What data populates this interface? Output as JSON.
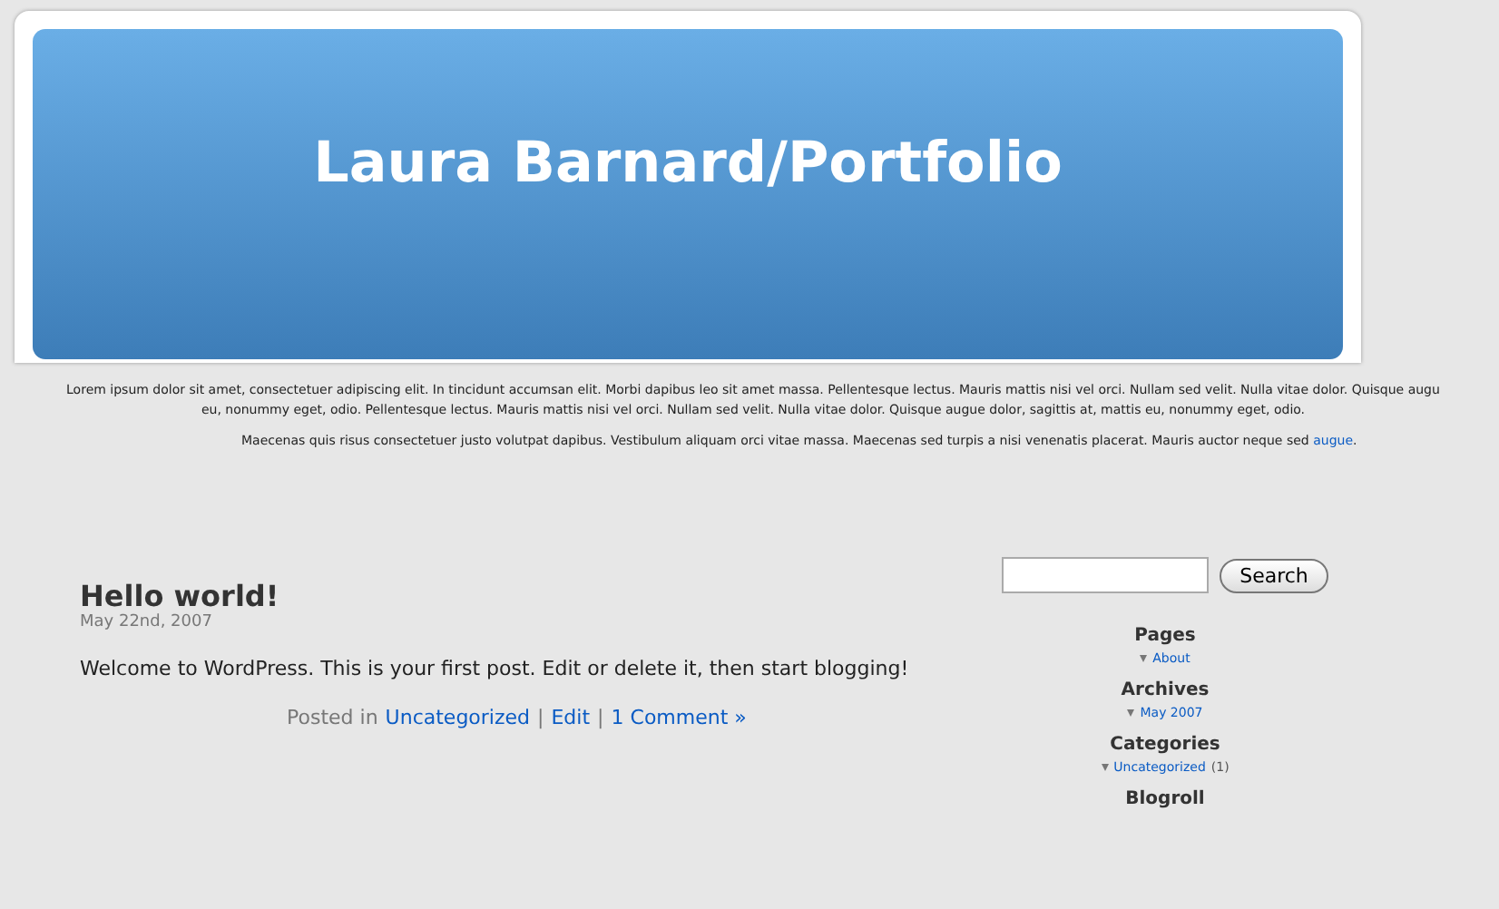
{
  "header": {
    "title": "Laura Barnard/Portfolio"
  },
  "intro": {
    "lines": [
      "Lorem ipsum dolor sit amet, consectetuer adipiscing elit. In tincidunt accumsan elit. Morbi dapibus leo sit amet massa. Pellentesque lectus. Mauris mattis nisi vel orci. Nullam sed velit. Nulla vitae dolor. Quisque augu",
      "eu, nonummy eget, odio. Pellentesque lectus. Mauris mattis nisi vel orci. Nullam sed velit. Nulla vitae dolor. Quisque augue dolor, sagittis at, mattis eu, nonummy eget, odio."
    ],
    "paragraph": "Maecenas quis risus consectetuer justo volutpat dapibus. Vestibulum aliquam orci vitae massa. Maecenas sed turpis a nisi venenatis placerat. Mauris auctor neque sed",
    "link": "augue",
    "end": "."
  },
  "post": {
    "title": "Hello world!",
    "date": "May 22nd, 2007",
    "body": "Welcome to WordPress. This is your first post. Edit or delete it, then start blogging!",
    "posted_in": "Posted in",
    "category": "Uncategorized",
    "separator": "|",
    "edit": "Edit",
    "comments": "1 Comment »"
  },
  "sidebar": {
    "search_button": "Search",
    "sections": [
      {
        "title": "Pages",
        "items": [
          {
            "label": "About"
          }
        ]
      },
      {
        "title": "Archives",
        "items": [
          {
            "label": "May 2007"
          }
        ]
      },
      {
        "title": "Categories",
        "items": [
          {
            "label": "Uncategorized",
            "count": "(1)"
          }
        ]
      },
      {
        "title": "Blogroll"
      }
    ]
  }
}
